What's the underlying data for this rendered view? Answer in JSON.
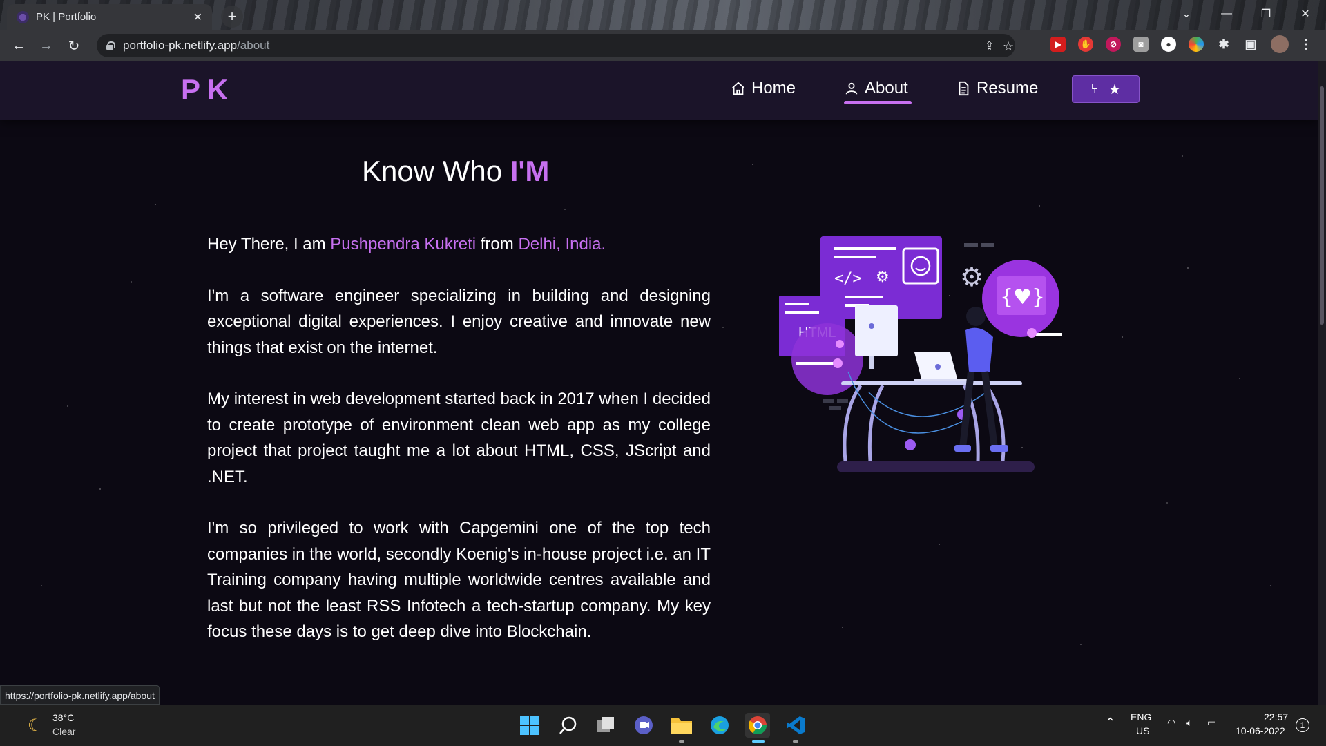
{
  "browser": {
    "tab_title": "PK | Portfolio",
    "url_host": "portfolio-pk.netlify.app",
    "url_path": "/about",
    "status_url": "https://portfolio-pk.netlify.app/about"
  },
  "site": {
    "logo": "PK",
    "nav": {
      "home": "Home",
      "about": "About",
      "resume": "Resume",
      "active": "About"
    }
  },
  "about": {
    "heading_main": "Know Who ",
    "heading_accent": "I'M",
    "intro_prefix": "Hey There, I am ",
    "name": "Pushpendra Kukreti",
    "intro_middle": " from ",
    "location": "Delhi, India.",
    "paragraph_1": "I'm a software engineer specializing in building and designing exceptional digital experiences. I enjoy creative and innovate new things that exist on the internet.",
    "paragraph_2": "My interest in web development started back in 2017 when I decided to create prototype of environment clean web app as my college project that project taught me a lot about HTML, CSS, JScript and .NET.",
    "paragraph_3": "I'm so privileged to work with Capgemini one of the top tech companies in the world, secondly Koenig's in-house project i.e. an IT Training company having multiple worldwide centres available and last but not the least RSS Infotech a tech-startup company. My key focus these days is to get deep dive into Blockchain.",
    "illustration_label": "HTML"
  },
  "taskbar": {
    "weather_temp": "38°C",
    "weather_condition": "Clear",
    "lang_top": "ENG",
    "lang_bottom": "US",
    "time": "22:57",
    "date": "10-06-2022",
    "notification_count": "1"
  },
  "colors": {
    "accent": "#c770f0",
    "navbar_bg": "#1b1429",
    "page_bg": "#0c0913",
    "github_button": "#5e2ea3"
  }
}
